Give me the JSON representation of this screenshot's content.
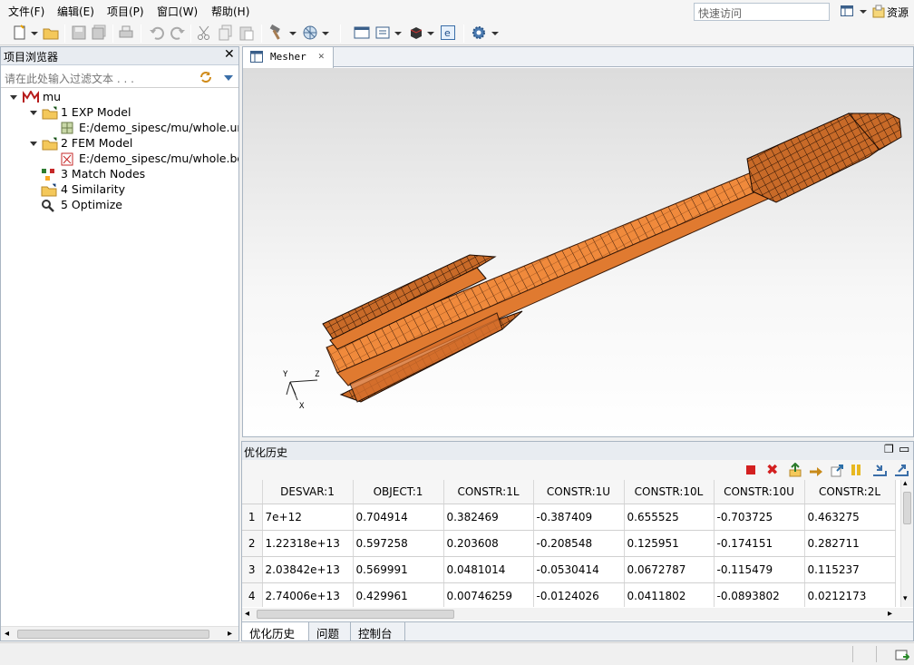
{
  "menu": {
    "items": [
      "文件(F)",
      "编辑(E)",
      "项目(P)",
      "窗口(W)",
      "帮助(H)"
    ],
    "quick_access_placeholder": "快速访问",
    "resources_label": "资源"
  },
  "icons": {
    "new": "new-file-icon",
    "open": "open-folder-icon",
    "save": "save-icon",
    "save_all": "save-all-icon",
    "print": "print-icon",
    "undo": "undo-icon",
    "redo": "redo-icon",
    "cut": "cut-icon",
    "copy": "copy-icon",
    "paste": "paste-icon",
    "build": "hammer-icon",
    "mesh": "mesh-icon",
    "window": "window-icon",
    "view": "view-icon",
    "cube": "cube-icon",
    "e": "e-icon",
    "settings": "gear-icon"
  },
  "project_explorer": {
    "title": "项目浏览器",
    "filter_placeholder": "请在此处输入过滤文本 . . .",
    "tree": {
      "root": "mu",
      "items": [
        {
          "label": "1 EXP Model",
          "child": "E:/demo_sipesc/mu/whole.unv"
        },
        {
          "label": "2 FEM Model",
          "child": "E:/demo_sipesc/mu/whole.bdf"
        },
        {
          "label": "3 Match Nodes"
        },
        {
          "label": "4 Similarity"
        },
        {
          "label": "5 Optimize"
        }
      ]
    }
  },
  "editor": {
    "tab_label": "Mesher",
    "axes": {
      "y": "Y",
      "z": "Z",
      "x": "X"
    }
  },
  "history": {
    "title": "优化历史",
    "columns": [
      "DESVAR:1",
      "OBJECT:1",
      "CONSTR:1L",
      "CONSTR:1U",
      "CONSTR:10L",
      "CONSTR:10U",
      "CONSTR:2L"
    ],
    "rows": [
      {
        "n": "1",
        "cells": [
          "7e+12",
          "0.704914",
          "0.382469",
          "-0.387409",
          "0.655525",
          "-0.703725",
          "0.463275"
        ]
      },
      {
        "n": "2",
        "cells": [
          "1.22318e+13",
          "0.597258",
          "0.203608",
          "-0.208548",
          "0.125951",
          "-0.174151",
          "0.282711"
        ]
      },
      {
        "n": "3",
        "cells": [
          "2.03842e+13",
          "0.569991",
          "0.0481014",
          "-0.0530414",
          "0.0672787",
          "-0.115479",
          "0.115237"
        ]
      },
      {
        "n": "4",
        "cells": [
          "2.74006e+13",
          "0.429961",
          "0.00746259",
          "-0.0124026",
          "0.0411802",
          "-0.0893802",
          "0.0212173"
        ]
      }
    ],
    "tabs": [
      "优化历史",
      "问题",
      "控制台"
    ]
  },
  "colors": {
    "mesh_orange": "#f08a3c",
    "stop_red": "#d32020"
  }
}
